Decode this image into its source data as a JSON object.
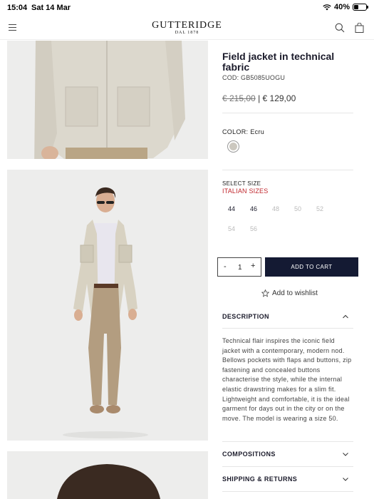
{
  "status": {
    "time": "15:04",
    "date": "Sat 14 Mar",
    "battery": "40%",
    "battery_level": 0.4
  },
  "header": {
    "logo": "GUTTERIDGE",
    "logo_sub": "DAL 1878"
  },
  "product": {
    "title": "Field jacket in technical fabric",
    "code": "COD: GB5085UOGU",
    "old_price": "€ 215,00",
    "separator": "|",
    "price": "€ 129,00",
    "color_label": "COLOR:",
    "color_value": "Ecru",
    "swatch_color": "#ccc8bf",
    "size_label": "SELECT SIZE",
    "size_system": "ITALIAN SIZES",
    "sizes": [
      {
        "label": "44",
        "available": true
      },
      {
        "label": "46",
        "available": true
      },
      {
        "label": "48",
        "available": false
      },
      {
        "label": "50",
        "available": false
      },
      {
        "label": "52",
        "available": false
      },
      {
        "label": "54",
        "available": false
      },
      {
        "label": "56",
        "available": false
      }
    ],
    "quantity": "1",
    "qty_minus": "-",
    "qty_plus": "+",
    "add_to_cart": "ADD TO CART",
    "wishlist": "Add to wishlist"
  },
  "accordion": {
    "description": "DESCRIPTION",
    "description_text": "Technical flair inspires the iconic field jacket with a contemporary, modern nod. Bellows pockets with flaps and buttons, zip fastening and concealed buttons characterise the style, while the internal elastic drawstring makes for a slim fit. Lightweight and comfortable, it is the ideal garment for days out in the city or on the move. The model is wearing a size 50.",
    "compositions": "COMPOSITIONS",
    "shipping": "SHIPPING & RETURNS"
  },
  "colors": {
    "accent": "#141a33",
    "size_system": "#c0272d",
    "image_bg": "#ededec"
  },
  "icons": [
    "menu-icon",
    "search-icon",
    "bag-icon",
    "wifi-icon",
    "battery-icon",
    "star-icon",
    "chevron-up-icon",
    "chevron-down-icon"
  ]
}
